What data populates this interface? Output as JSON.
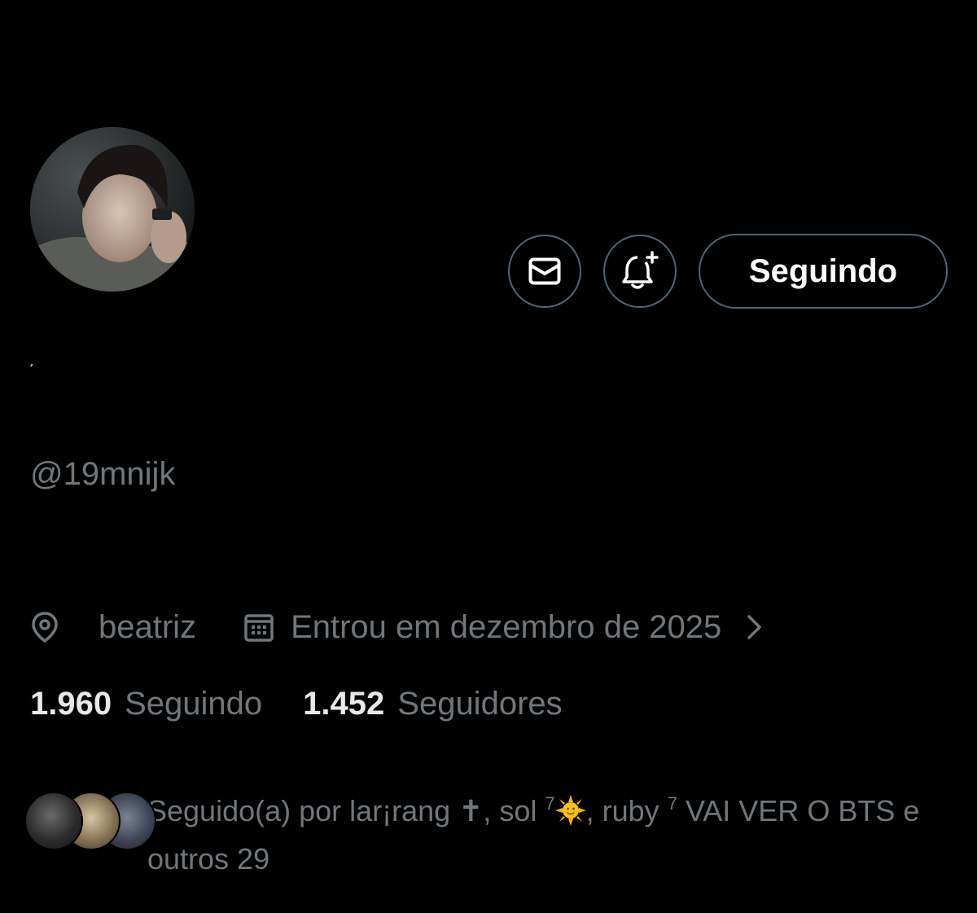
{
  "profile": {
    "display_name": "ˏ",
    "handle": "@19mnijk",
    "location": "beatriz",
    "joined": "Entrou em dezembro de 2025",
    "chevron": "›"
  },
  "actions": {
    "message_icon": "mail-icon",
    "notify_icon": "bell-plus-icon",
    "follow_label": "Seguindo"
  },
  "stats": {
    "following_count": "1.960",
    "following_label": "Seguindo",
    "followers_count": "1.452",
    "followers_label": "Seguidores"
  },
  "followed_by": {
    "prefix": "Seguido(a) por lar¡rang ✝, sol ",
    "sup1": "7",
    "middle": ", ruby ",
    "sup2": "7",
    "suffix": " VAI VER O BTS e outros 29"
  },
  "colors": {
    "background": "#000000",
    "text_primary": "#e7e9ea",
    "text_secondary": "#71767b",
    "border": "#536471"
  }
}
